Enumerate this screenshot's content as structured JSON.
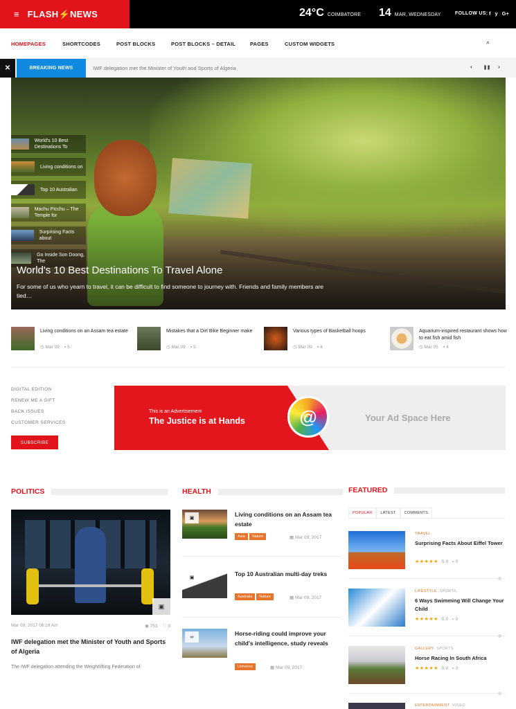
{
  "topbar": {
    "logo": "FLASH",
    "logo_bolt": "⚡",
    "logo_suffix": "NEWS",
    "menu_icon": "≡",
    "temp": "24°C",
    "city": "COIMBATORE",
    "day": "14",
    "date_text": "MAR, WEDNESDAY",
    "follow_label": "FOLLOW US:",
    "social": [
      "f",
      "y",
      "G+"
    ]
  },
  "nav": {
    "items": [
      "HOMEPAGES",
      "SHORTCODES",
      "POST BLOCKS",
      "POST BLOCKS – DETAIL",
      "PAGES",
      "CUSTOM WIDGETS"
    ],
    "search_icon": "⌕"
  },
  "breaking": {
    "label": "BREAKING NEWS",
    "text": "IWF delegation met the Minister of Youth and Sports of Algeria",
    "prev": "‹",
    "pause": "❚❚",
    "next": "›"
  },
  "hero": {
    "title": "World's 10 Best Destinations To Travel Alone",
    "subtitle": "For some of us who yearn to travel, it can be difficult to find someone to journey with. Friends and family members are tied…",
    "thumbs": [
      "World's 10 Best Destinations To",
      "Living conditions on",
      "Top 10 Australian",
      "Machu Picchu – The Temple for",
      "Surprising Facts about",
      "Go Inside Son Doong, The"
    ]
  },
  "related": [
    {
      "title": "Living conditions on an Assam tea estate",
      "date": "Mar 09",
      "comments": "5"
    },
    {
      "title": "Mistakes that a Dirt Bike Beginner make",
      "date": "Mar 09",
      "comments": "5"
    },
    {
      "title": "Various types of Basketball hoops",
      "date": "Mar 09",
      "comments": "4"
    },
    {
      "title": "Aquarium-inspired restaurant shows how to eat fish amid fish",
      "date": "Mar 05",
      "comments": "4"
    }
  ],
  "side_links": [
    "DIGITAL EDITION",
    "RENEW ME A GIFT",
    "BACK ISSUES",
    "CUSTOMER SERVICES"
  ],
  "subscribe": "SUBSCRIBE",
  "ad": {
    "small": "This is an Advertisement",
    "big": "The Justice is at Hands",
    "logo": "@",
    "space": "Your Ad Space Here"
  },
  "politics": {
    "heading": "POLITICS",
    "meta_date": "Mar 09, 2017 08:19 Am",
    "views": "◉ 753",
    "likes": "♡ 0",
    "title": "IWF delegation met the Minister of Youth and Sports of Algeria",
    "desc": "The IWF delegation attending the Weightlifting Federation of"
  },
  "health": {
    "heading": "HEALTH",
    "items": [
      {
        "title": "Living conditions on an Assam tea estate",
        "tags": [
          "Asia",
          "Nature"
        ],
        "date": "Mar 09, 2017"
      },
      {
        "title": "Top 10 Australian multi-day treks",
        "tags": [
          "Australia",
          "Nature"
        ],
        "date": "Mar 09, 2017"
      },
      {
        "title": "Horse-riding could improve your child's intelligence, study reveals",
        "tags": [
          "Universe"
        ],
        "date": "Mar 09, 2017"
      }
    ]
  },
  "featured": {
    "heading": "FEATURED",
    "tabs": [
      "POPULAR",
      "LATEST",
      "COMMENTS"
    ],
    "items": [
      {
        "cat": "TRAVEL",
        "cat2": "",
        "title": "Surprising Facts About Eiffel Tower",
        "stars": "★★★★★",
        "rating": "5.0",
        "comments": "0"
      },
      {
        "cat": "LIFESTYLE",
        "cat2": "SPORTS",
        "title": "6 Ways Swimming Will Change Your Child",
        "stars": "★★★★★",
        "rating": "5.0",
        "comments": "0"
      },
      {
        "cat": "GALLERY",
        "cat2": "SPORTS",
        "title": "Horse Racing In South Africa",
        "stars": "★★★★★",
        "rating": "5.0",
        "comments": "0"
      },
      {
        "cat": "ENTERTAINMENT",
        "cat2": "VIDEO",
        "title": "",
        "stars": "",
        "rating": "",
        "comments": ""
      }
    ]
  },
  "colors": {
    "accent": "#e3131b",
    "breaking": "#0f8ae0",
    "tag": "#e8732a"
  }
}
